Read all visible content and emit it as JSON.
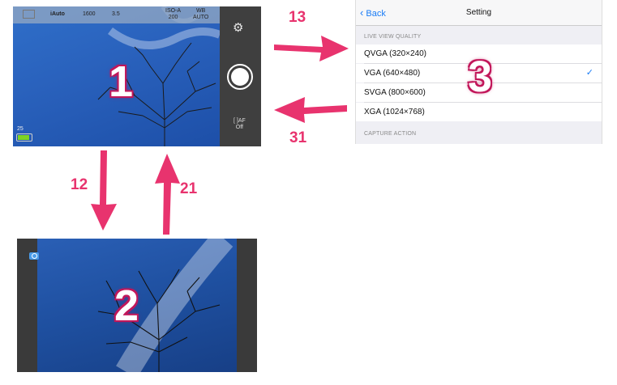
{
  "screen1": {
    "number": "1",
    "status_bar": {
      "mode": "iAuto",
      "shutter": "1600",
      "aperture": "3.5",
      "iso_line1": "ISO-A",
      "iso_line2": "200",
      "wb_line1": "WB",
      "wb_line2": "AUTO"
    },
    "battery_level": "25",
    "af_line1": "[ ]AF",
    "af_line2": "Off",
    "icons": [
      "gear-icon",
      "shutter-button-icon",
      "battery-icon"
    ]
  },
  "screen2": {
    "number": "2",
    "icons": [
      "camera-icon"
    ]
  },
  "screen3": {
    "number": "3",
    "back_label": "Back",
    "title": "Setting",
    "section1": "LIVE VIEW QUALITY",
    "options": [
      {
        "label": "QVGA (320×240)",
        "selected": false
      },
      {
        "label": "VGA (640×480)",
        "selected": true
      },
      {
        "label": "SVGA (800×600)",
        "selected": false
      },
      {
        "label": "XGA (1024×768)",
        "selected": false
      }
    ],
    "section2": "CAPTURE ACTION"
  },
  "arrows": {
    "a13": "13",
    "a31": "31",
    "a12": "12",
    "a21": "21",
    "color": "#e8336e"
  }
}
